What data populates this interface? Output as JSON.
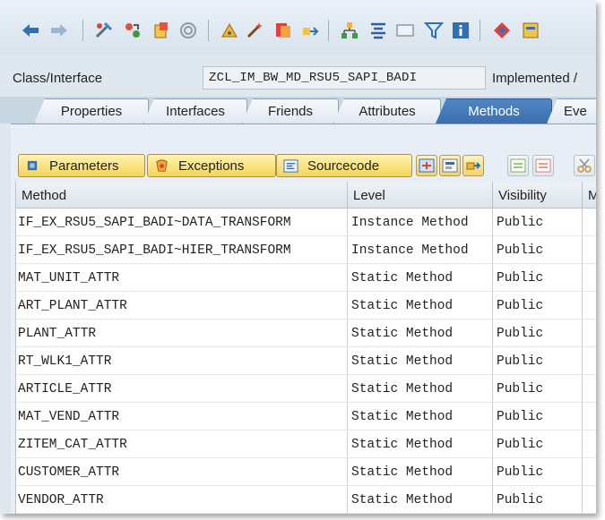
{
  "class_interface": {
    "label": "Class/Interface",
    "value": "ZCL_IM_BW_MD_RSU5_SAPI_BADI",
    "implemented_label": "Implemented /"
  },
  "tabs": [
    {
      "label": "Properties",
      "active": false
    },
    {
      "label": "Interfaces",
      "active": false
    },
    {
      "label": "Friends",
      "active": false
    },
    {
      "label": "Attributes",
      "active": false
    },
    {
      "label": "Methods",
      "active": true
    },
    {
      "label": "Eve",
      "active": false
    }
  ],
  "sub_toolbar": {
    "parameters_label": "Parameters",
    "exceptions_label": "Exceptions",
    "sourcecode_label": "Sourcecode"
  },
  "table": {
    "columns": [
      "Method",
      "Level",
      "Visibility",
      "M"
    ],
    "rows": [
      [
        "IF_EX_RSU5_SAPI_BADI~DATA_TRANSFORM",
        "Instance Method",
        "Public"
      ],
      [
        "IF_EX_RSU5_SAPI_BADI~HIER_TRANSFORM",
        "Instance Method",
        "Public"
      ],
      [
        "MAT_UNIT_ATTR",
        "Static Method",
        "Public"
      ],
      [
        "ART_PLANT_ATTR",
        "Static Method",
        "Public"
      ],
      [
        "PLANT_ATTR",
        "Static Method",
        "Public"
      ],
      [
        "RT_WLK1_ATTR",
        "Static Method",
        "Public"
      ],
      [
        "ARTICLE_ATTR",
        "Static Method",
        "Public"
      ],
      [
        "MAT_VEND_ATTR",
        "Static Method",
        "Public"
      ],
      [
        "ZITEM_CAT_ATTR",
        "Static Method",
        "Public"
      ],
      [
        "CUSTOMER_ATTR",
        "Static Method",
        "Public"
      ],
      [
        "VENDOR_ATTR",
        "Static Method",
        "Public"
      ]
    ]
  },
  "toolbar_icons": [
    "back-arrow-icon",
    "forward-arrow-icon",
    "other-object-icon",
    "display-change-icon",
    "active-inactive-icon",
    "object-list-icon",
    "where-used-icon",
    "magic-wand-icon",
    "check-icon",
    "activate-icon",
    "hierarchy-icon",
    "pretty-printer-icon",
    "fullscreen-icon",
    "filter-icon",
    "info-icon",
    "enhance-icon",
    "local-types-icon"
  ],
  "colors": {
    "active_tab": "#3b6fad",
    "sub_button": "#f4d55a",
    "background": "#dfe7ef"
  }
}
